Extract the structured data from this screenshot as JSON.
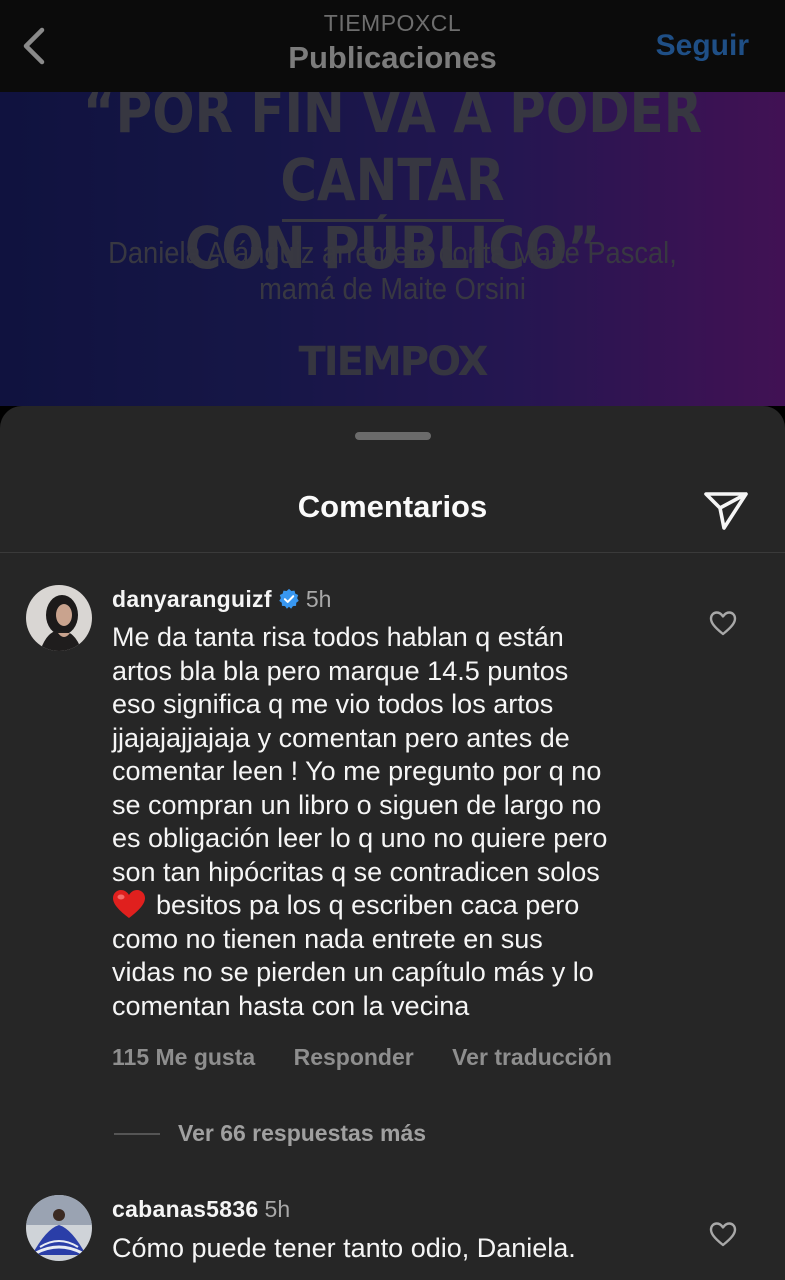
{
  "header": {
    "account": "TIEMPOXCL",
    "title": "Publicaciones",
    "follow_label": "Seguir",
    "back_icon": "chevron-left-icon"
  },
  "post": {
    "headline": [
      "“POR FIN VA A PODER CANTAR",
      "CON PÚBLICO”"
    ],
    "subline": [
      "Daniela Aránguiz arremete conta Maite Pascal,",
      "mamá de Maite Orsini"
    ],
    "brand": "TIEMPOX"
  },
  "comments_sheet": {
    "title": "Comentarios",
    "share_icon": "send-icon",
    "comments": [
      {
        "username": "danyaranguizf",
        "verified": true,
        "time": "5h",
        "text_lines": [
          "Me da tanta risa todos hablan q están",
          "artos bla bla pero marque 14.5 puntos",
          "eso significa q me vio todos los artos",
          "jjajajajjajaja y comentan pero antes de",
          "comentar leen ! Yo me pregunto por q no",
          "se compran un libro o siguen de largo no",
          "es obligación leer lo q uno no quiere pero",
          "son tan hipócritas q se contradicen solos",
          "besitos pa los q escriben caca pero",
          "como no tienen nada entrete en sus",
          "vidas no se pierden un capítulo más y lo",
          "comentan hasta con la vecina"
        ],
        "emoji": "red-heart",
        "likes": "115 Me gusta",
        "reply_label": "Responder",
        "translate_label": "Ver traducción",
        "more_replies": "Ver 66 respuestas más"
      },
      {
        "username": "cabanas5836",
        "verified": false,
        "time": "5h",
        "text_lines": [
          "Cómo puede tener tanto odio, Daniela."
        ]
      }
    ]
  }
}
